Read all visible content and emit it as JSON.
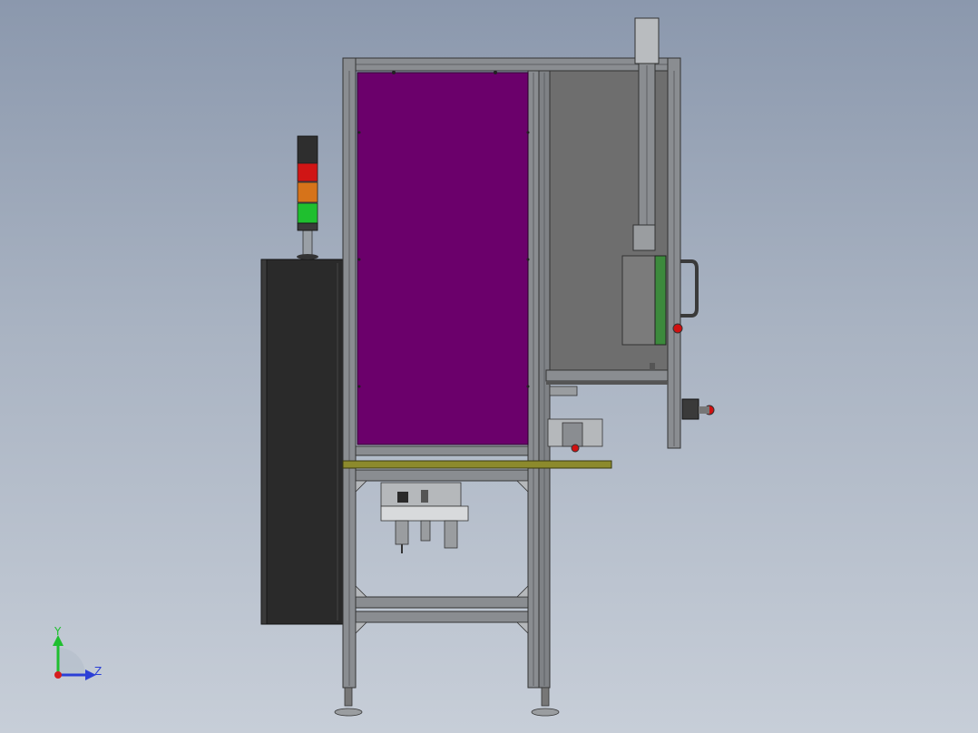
{
  "view": {
    "background_top": "#8b98ad",
    "background_bottom": "#c7ced8"
  },
  "triad": {
    "y_label": "Y",
    "z_label": "Z",
    "y_color": "#1fbf2f",
    "z_color": "#2b3fd6",
    "x_color": "#d61e1e"
  },
  "colors": {
    "panel_purple": "#6b006b",
    "frame_gray": "#8a8d91",
    "frame_dark": "#4a4c4f",
    "cabinet_dark": "#2a2a2a",
    "door_gray": "#6e6e6e",
    "shelf_olive": "#8c8a2c",
    "beacon_red": "#d01515",
    "beacon_orange": "#d6731a",
    "beacon_green": "#1fbf2f",
    "estop_red": "#d01010"
  },
  "components": [
    "signal-tower",
    "electrical-cabinet",
    "aluminum-frame",
    "purple-panel",
    "door-panel",
    "linear-actuator",
    "door-handle",
    "emergency-stop",
    "olive-shelf",
    "pneumatic-frl-unit",
    "leveling-feet"
  ]
}
